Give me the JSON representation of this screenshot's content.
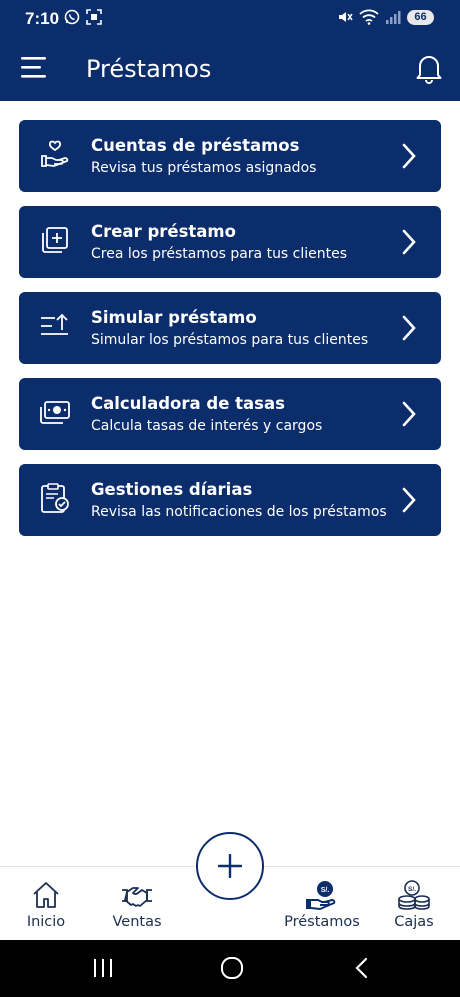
{
  "status_bar": {
    "time": "7:10",
    "battery": "66",
    "signal_label": "5"
  },
  "header": {
    "title": "Préstamos"
  },
  "menu": [
    {
      "title": "Cuentas de préstamos",
      "subtitle": "Revisa tus préstamos asignados",
      "icon": "hand-heart-icon"
    },
    {
      "title": "Crear préstamo",
      "subtitle": "Crea los préstamos para tus clientes",
      "icon": "add-copy-icon"
    },
    {
      "title": "Simular préstamo",
      "subtitle": "Simular los préstamos para tus clientes",
      "icon": "sort-up-icon"
    },
    {
      "title": "Calculadora de tasas",
      "subtitle": "Calcula tasas de interés y cargos",
      "icon": "cash-icon"
    },
    {
      "title": "Gestiones díarias",
      "subtitle": "Revisa las notificaciones de los préstamos",
      "icon": "clipboard-check-icon"
    }
  ],
  "bottom_nav": {
    "items": [
      {
        "label": "Inicio",
        "icon": "home-icon",
        "active": false
      },
      {
        "label": "Ventas",
        "icon": "handshake-icon",
        "active": false
      },
      {
        "label": "Préstamos",
        "icon": "loan-hand-icon",
        "active": true,
        "badge": "S/."
      },
      {
        "label": "Cajas",
        "icon": "coins-icon",
        "active": false,
        "badge": "S/."
      }
    ],
    "fab_icon": "plus-icon"
  },
  "colors": {
    "primary": "#0c2d6b",
    "background": "#ffffff",
    "text_dark": "#1c2e52"
  }
}
